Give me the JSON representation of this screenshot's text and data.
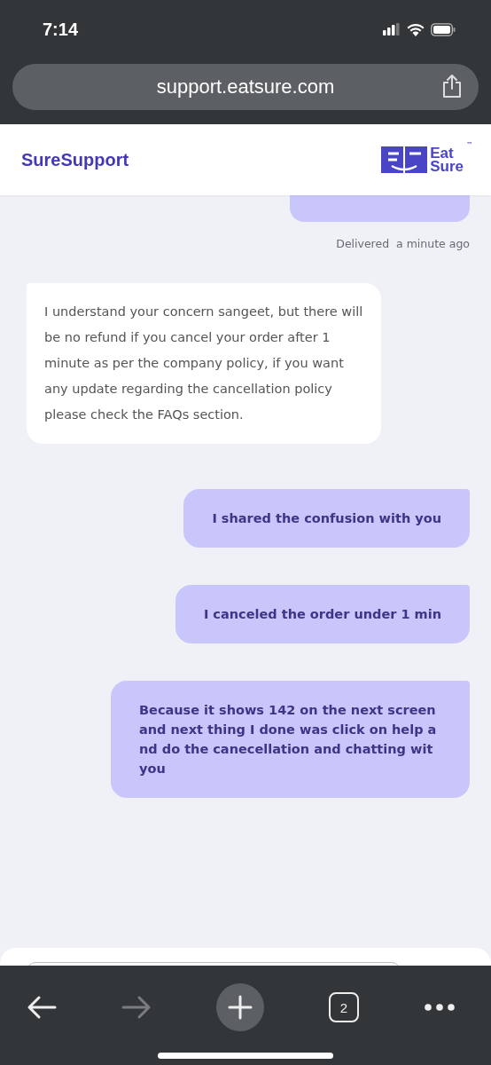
{
  "status_bar": {
    "time": "7:14"
  },
  "browser": {
    "url": "support.eatsure.com",
    "tab_count": "2",
    "forward_disabled": true
  },
  "header": {
    "title": "SureSupport",
    "logo": {
      "line_1": "Eat",
      "line_2": "Sure",
      "mark": "™"
    }
  },
  "messages": [
    {
      "kind": "user_partial"
    },
    {
      "kind": "status",
      "label": "Delivered",
      "time": "a minute ago"
    },
    {
      "kind": "agent",
      "text": "I understand your concern sangeet, but there will be no refund if you cancel your order after 1 minute as per the company policy, if you want any update regarding the cancellation policy please check the FAQs section."
    },
    {
      "kind": "user",
      "text": "I shared the confusion with you"
    },
    {
      "kind": "user",
      "text": "I canceled the order under 1 min"
    },
    {
      "kind": "user",
      "text": "Because it shows 142 on the next screen and next thing I done was click on help and do the canecellation and chatting wit you"
    }
  ]
}
